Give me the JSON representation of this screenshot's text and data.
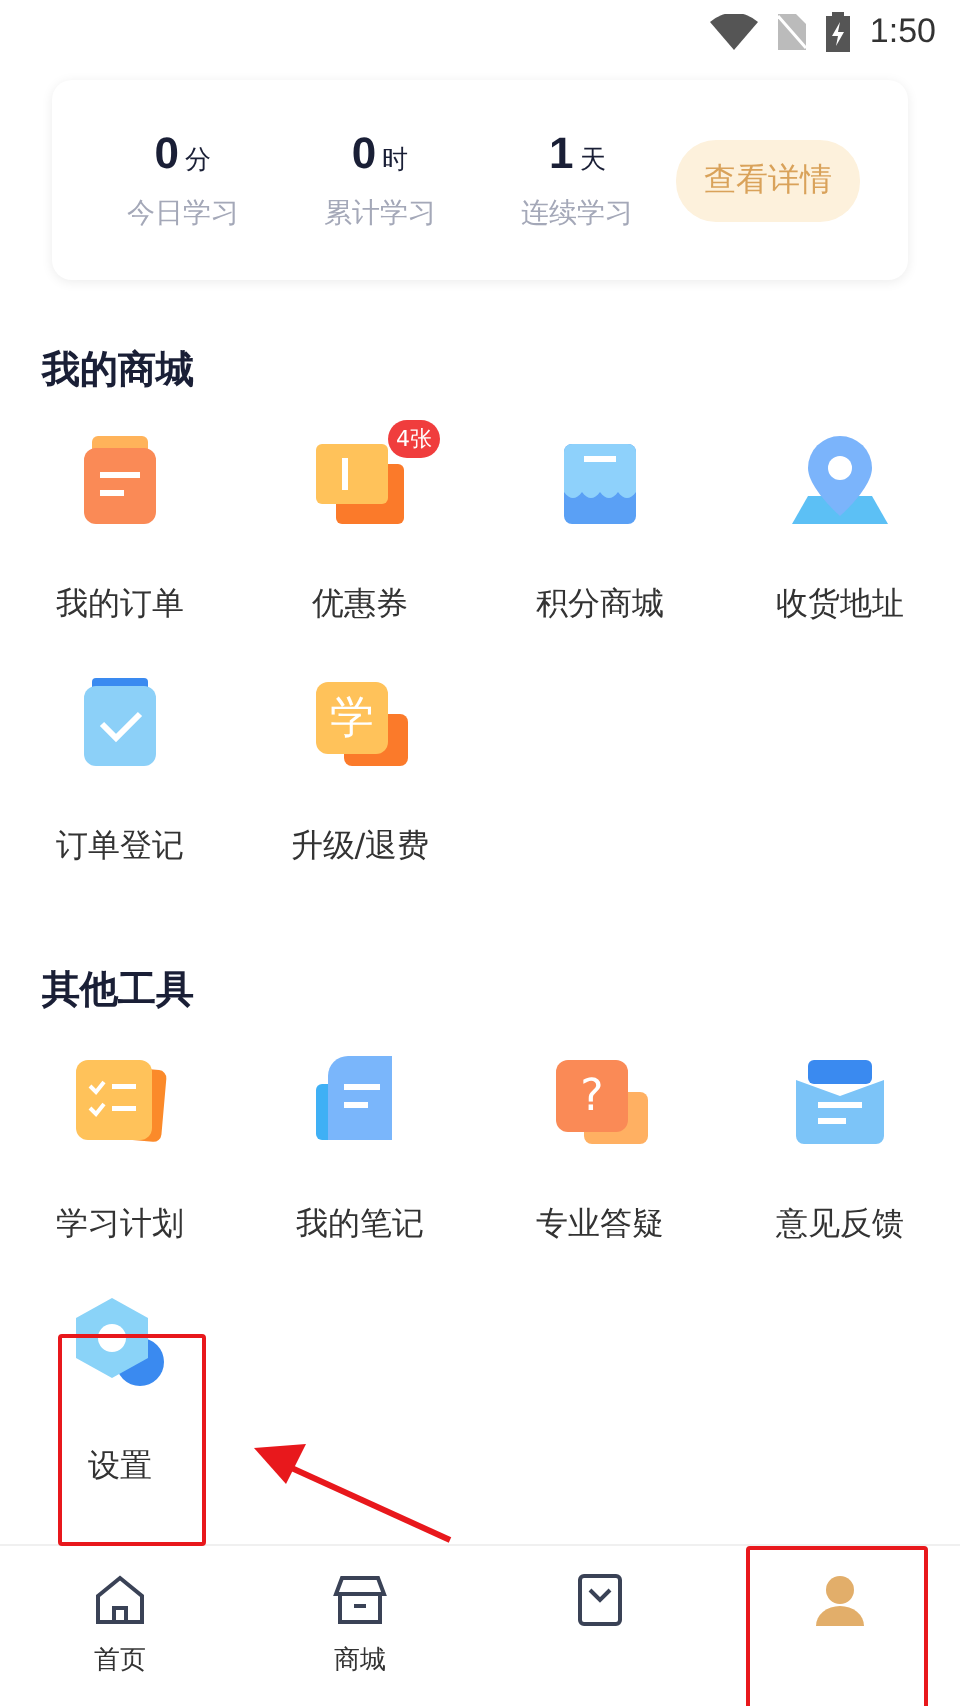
{
  "status_bar": {
    "time": "1:50"
  },
  "stats": [
    {
      "value": "0",
      "unit": "分",
      "label": "今日学习"
    },
    {
      "value": "0",
      "unit": "时",
      "label": "累计学习"
    },
    {
      "value": "1",
      "unit": "天",
      "label": "连续学习"
    }
  ],
  "details_button": "查看详情",
  "sections": [
    {
      "title": "我的商城",
      "items": [
        {
          "kind": "order",
          "label": "我的订单"
        },
        {
          "kind": "coupon",
          "label": "优惠券",
          "badge": "4张"
        },
        {
          "kind": "store",
          "label": "积分商城"
        },
        {
          "kind": "location",
          "label": "收货地址"
        },
        {
          "kind": "check",
          "label": "订单登记"
        },
        {
          "kind": "study",
          "label": "升级/退费",
          "glyph": "学"
        }
      ]
    },
    {
      "title": "其他工具",
      "items": [
        {
          "kind": "plan",
          "label": "学习计划"
        },
        {
          "kind": "note",
          "label": "我的笔记"
        },
        {
          "kind": "question",
          "label": "专业答疑",
          "glyph": "?"
        },
        {
          "kind": "mail",
          "label": "意见反馈"
        },
        {
          "kind": "settings",
          "label": "设置"
        }
      ]
    }
  ],
  "tabs": [
    {
      "kind": "home",
      "label": "首页",
      "selected": false
    },
    {
      "kind": "shop",
      "label": "商城",
      "selected": false
    },
    {
      "kind": "book",
      "selected": false
    },
    {
      "kind": "person",
      "selected": true
    }
  ]
}
